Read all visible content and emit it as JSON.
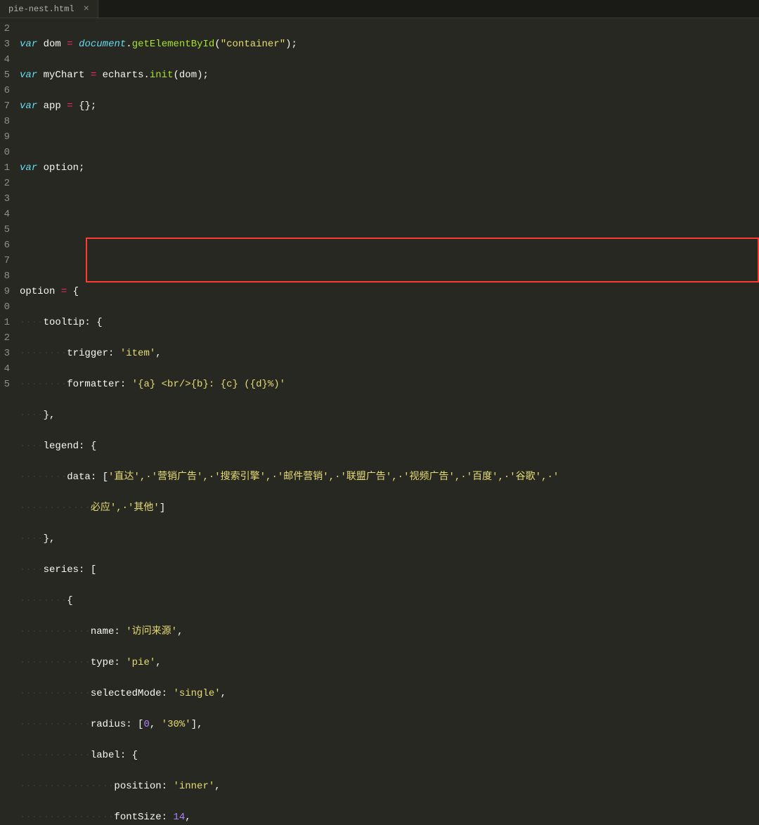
{
  "tab": {
    "name": "pie-nest.html",
    "close": "×"
  },
  "gutter": [
    "2",
    "3",
    "4",
    "5",
    "6",
    "7",
    "8",
    "9",
    "0",
    "1",
    "2",
    "3",
    "4",
    "5",
    "6",
    "7",
    "8",
    "9",
    "0",
    "1",
    "2",
    "3",
    "4",
    "5"
  ],
  "code": {
    "l2": {
      "var": "var",
      "dom": "dom",
      "eq": "=",
      "document": "document",
      "dot": ".",
      "getElementById": "getElementById",
      "lp": "(",
      "str": "\"container\"",
      "rp": ")",
      "semi": ";"
    },
    "l3": {
      "var": "var",
      "myChart": "myChart",
      "eq": "=",
      "echarts": "echarts",
      "dot": ".",
      "init": "init",
      "lp": "(",
      "dom": "dom",
      "rp": ")",
      "semi": ";"
    },
    "l4": {
      "var": "var",
      "app": "app",
      "eq": "=",
      "obj": "{}",
      "semi": ";"
    },
    "l6": {
      "var": "var",
      "option": "option",
      "semi": ";"
    },
    "l10": {
      "option": "option",
      "eq": "=",
      "lb": "{"
    },
    "l11": {
      "ws": "····",
      "tooltip": "tooltip:",
      "lb": "{"
    },
    "l12": {
      "ws": "········",
      "trigger": "trigger:",
      "val": "'item'",
      "c": ","
    },
    "l13": {
      "ws": "········",
      "formatter": "formatter:",
      "val": "'{a} <br/>{b}: {c} ({d}%)'"
    },
    "l14": {
      "ws": "····",
      "rb": "},",
      "c": ""
    },
    "l15": {
      "ws": "····",
      "legend": "legend:",
      "lb": "{"
    },
    "l16": {
      "ws": "········",
      "data": "data:",
      "lb": "[",
      "items": "'直达',·'营销广告',·'搜索引擎',·'邮件营销',·'联盟广告',·'视频广告',·'百度',·'谷歌',·'"
    },
    "l16b": {
      "ws": "············",
      "items": "必应',·'其他'",
      "rb": "]"
    },
    "l17": {
      "ws": "····",
      "rb": "},"
    },
    "l18": {
      "ws": "····",
      "series": "series:",
      "lb": "["
    },
    "l19": {
      "ws": "········",
      "lb": "{"
    },
    "l20": {
      "ws": "············",
      "name": "name:",
      "val": "'访问来源'",
      "c": ","
    },
    "l21": {
      "ws": "············",
      "type": "type:",
      "val": "'pie'",
      "c": ","
    },
    "l22": {
      "ws": "············",
      "selectedMode": "selectedMode:",
      "val": "'single'",
      "c": ","
    },
    "l23": {
      "ws": "············",
      "radius": "radius:",
      "lb": "[",
      "zero": "0",
      "c1": ",",
      "pct": "'30%'",
      "rb": "]",
      "c": ","
    },
    "l24": {
      "ws": "············",
      "label": "label:",
      "lb": "{"
    },
    "l25": {
      "ws": "················",
      "position": "position:",
      "val": "'inner'",
      "c": ","
    },
    "l26": {
      "ws": "················",
      "fontSize": "fontSize:",
      "val": "14",
      "c": ","
    }
  }
}
